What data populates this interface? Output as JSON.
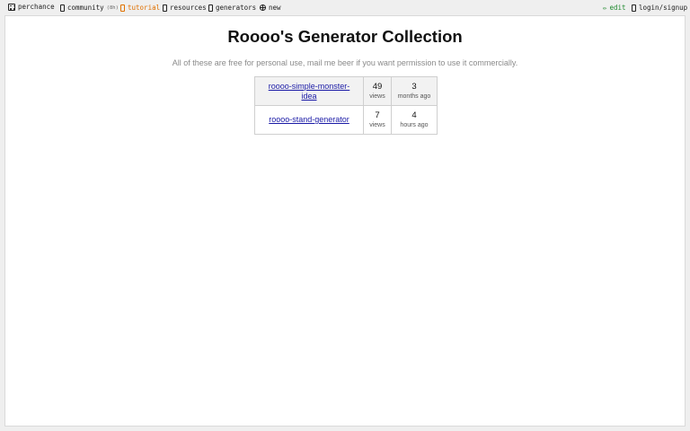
{
  "nav": {
    "home": {
      "label": "perchance",
      "icon": "die-icon"
    },
    "community": {
      "label": "community",
      "badge": "(8h)",
      "icon": "box-icon"
    },
    "tutorial": {
      "label": "tutorial",
      "icon": "box-icon",
      "color": "#e07000"
    },
    "resources": {
      "label": "resources",
      "icon": "box-icon"
    },
    "generators": {
      "label": "generators",
      "icon": "box-icon"
    },
    "new": {
      "label": "new",
      "icon": "globe-icon"
    },
    "edit": {
      "label": "edit",
      "icon": "pencil-icon",
      "color": "#1f8a2e"
    },
    "login": {
      "label": "login/signup",
      "icon": "box-icon"
    }
  },
  "page": {
    "title": "Roooo's Generator Collection",
    "subtitle": "All of these are free for personal use, mail me beer if you want permission to use it commercially."
  },
  "generators": [
    {
      "name_line1": "roooo-simple-monster-",
      "name_line2": "idea",
      "views": "49",
      "views_unit": "views",
      "age": "3",
      "age_unit": "months ago"
    },
    {
      "name_line1": "roooo-stand-generator",
      "name_line2": "",
      "views": "7",
      "views_unit": "views",
      "age": "4",
      "age_unit": "hours ago"
    }
  ]
}
